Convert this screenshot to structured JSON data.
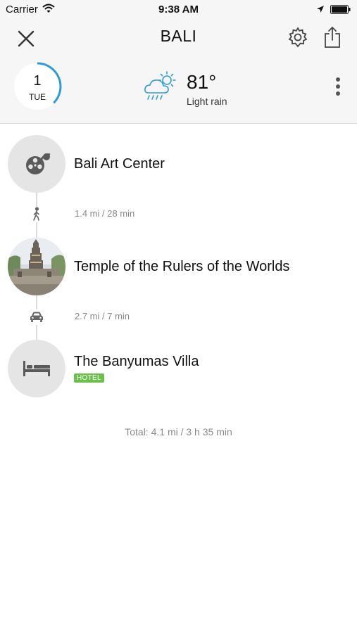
{
  "status_bar": {
    "carrier": "Carrier",
    "time": "9:38 AM"
  },
  "header": {
    "title": "BALI",
    "day_number": "1",
    "day_name": "TUE",
    "temperature": "81°",
    "condition": "Light rain",
    "icons": {
      "close": "close-icon",
      "settings": "gear-icon",
      "share": "share-icon",
      "weather": "rain-cloud-sun-icon",
      "more": "more-vertical-icon"
    }
  },
  "itinerary": {
    "stops": [
      {
        "name": "Bali Art Center",
        "icon": "film-reel-icon"
      },
      {
        "name": "Temple of the Rulers of the Worlds",
        "icon": "temple-photo"
      },
      {
        "name": "The Banyumas Villa",
        "icon": "bed-icon",
        "badge": "HOTEL"
      }
    ],
    "legs": [
      {
        "mode": "walk-icon",
        "text": "1.4 mi / 28 min"
      },
      {
        "mode": "car-icon",
        "text": "2.7 mi / 7 min"
      }
    ],
    "total": "Total: 4.1 mi / 3 h 35 min"
  },
  "colors": {
    "header_bg": "#f6f6f6",
    "accent_blue": "#2e9bd6",
    "hotel_badge": "#6cbf4b",
    "thumb_bg": "#e5e5e5"
  }
}
